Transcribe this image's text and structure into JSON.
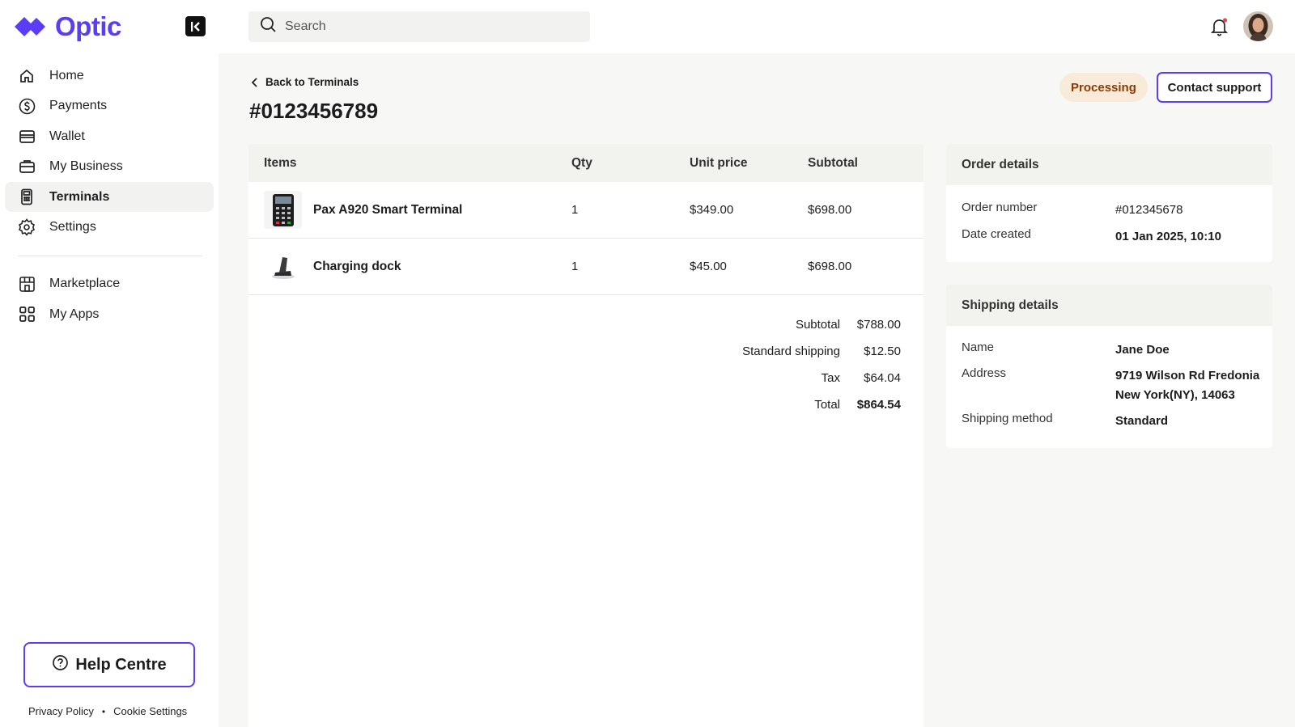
{
  "brand": {
    "name": "Optic"
  },
  "search": {
    "placeholder": "Search"
  },
  "sidebar": {
    "items": [
      {
        "label": "Home"
      },
      {
        "label": "Payments"
      },
      {
        "label": "Wallet"
      },
      {
        "label": "My Business"
      },
      {
        "label": "Terminals"
      },
      {
        "label": "Settings"
      },
      {
        "label": "Marketplace"
      },
      {
        "label": "My Apps"
      }
    ],
    "active": "Terminals",
    "help_label": "Help Centre",
    "footer": {
      "privacy": "Privacy Policy",
      "separator": "•",
      "cookies": "Cookie Settings"
    }
  },
  "page": {
    "back_label": "Back to Terminals",
    "title": "#0123456789",
    "status": "Processing",
    "support_label": "Contact support"
  },
  "items_table": {
    "headers": {
      "item": "Items",
      "qty": "Qty",
      "unit_price": "Unit price",
      "subtotal": "Subtotal"
    },
    "rows": [
      {
        "name": "Pax A920 Smart Terminal",
        "qty": "1",
        "unit_price": "$349.00",
        "subtotal": "$698.00"
      },
      {
        "name": "Charging dock",
        "qty": "1",
        "unit_price": "$45.00",
        "subtotal": "$698.00"
      }
    ]
  },
  "totals": {
    "subtotal_label": "Subtotal",
    "subtotal": "$788.00",
    "shipping_label": "Standard shipping",
    "shipping": "$12.50",
    "tax_label": "Tax",
    "tax": "$64.04",
    "total_label": "Total",
    "total": "$864.54"
  },
  "order_details": {
    "title": "Order details",
    "order_number_label": "Order number",
    "order_number": "#012345678",
    "date_label": "Date created",
    "date": "01 Jan 2025, 10:10"
  },
  "shipping_details": {
    "title": "Shipping details",
    "name_label": "Name",
    "name": "Jane Doe",
    "address_label": "Address",
    "address_line1": "9719 Wilson Rd Fredonia",
    "address_line2": "New York(NY), 14063",
    "method_label": "Shipping method",
    "method": "Standard"
  },
  "colors": {
    "accent": "#5b3df5",
    "status_bg": "#f9ebd9",
    "status_text": "#8a3a05",
    "notification_dot": "#e5484d"
  }
}
